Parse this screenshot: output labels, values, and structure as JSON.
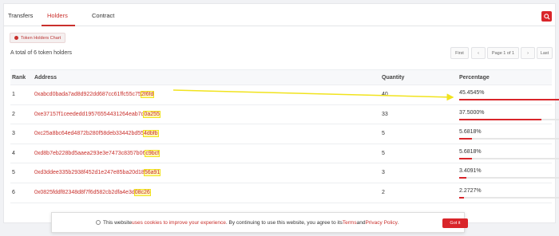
{
  "tabs": [
    {
      "label": "Transfers"
    },
    {
      "label": "Holders"
    },
    {
      "label": "Contract"
    }
  ],
  "chart_button_label": "Token Holders Chart",
  "summary": "A total of 6 token holders",
  "pager": {
    "first": "First",
    "prev": "‹",
    "page": "Page 1 of 1",
    "next": "›",
    "last": "Last"
  },
  "columns": {
    "rank": "Rank",
    "address": "Address",
    "quantity": "Quantity",
    "percentage": "Percentage"
  },
  "rows": [
    {
      "rank": "1",
      "address_main": "0xabcd0bada7ad8d922dd687cc61ffc55c75",
      "address_tail": "2f6fd",
      "quantity": "40",
      "percentage": "45.4545%",
      "pct": 0.4545
    },
    {
      "rank": "2",
      "address_main": "0xe37157f1ceededd19576554431264eab7d",
      "address_tail": "0a255",
      "quantity": "33",
      "percentage": "37.5000%",
      "pct": 0.375
    },
    {
      "rank": "3",
      "address_main": "0xc25a8bc64ed4872b280f58deb33442bd55",
      "address_tail": "4dbfb",
      "quantity": "5",
      "percentage": "5.6818%",
      "pct": 0.0568
    },
    {
      "rank": "4",
      "address_main": "0xd8b7eb228bd5aaea293e3e7473c8357b06",
      "address_tail": "c9bcf",
      "quantity": "5",
      "percentage": "5.6818%",
      "pct": 0.0568
    },
    {
      "rank": "5",
      "address_main": "0xd3ddee335b2938f452d1e247e85ba20d18",
      "address_tail": "56a91",
      "quantity": "3",
      "percentage": "3.4091%",
      "pct": 0.0341
    },
    {
      "rank": "6",
      "address_main": "0x0825fddf82348d8f7f6d582cb2dfa4e3d",
      "address_tail": "08c26",
      "quantity": "2",
      "percentage": "2.2727%",
      "pct": 0.0227
    }
  ],
  "cookie": {
    "pre": "This website ",
    "link1": "uses cookies to improve your experience",
    "mid": ". By continuing to use this website, you agree to its ",
    "terms": "Terms",
    "and": " and ",
    "privacy": "Privacy Policy",
    "end": ".",
    "button": "Got it"
  },
  "colors": {
    "accent": "#d9252a",
    "highlight": "#f1e31d"
  }
}
